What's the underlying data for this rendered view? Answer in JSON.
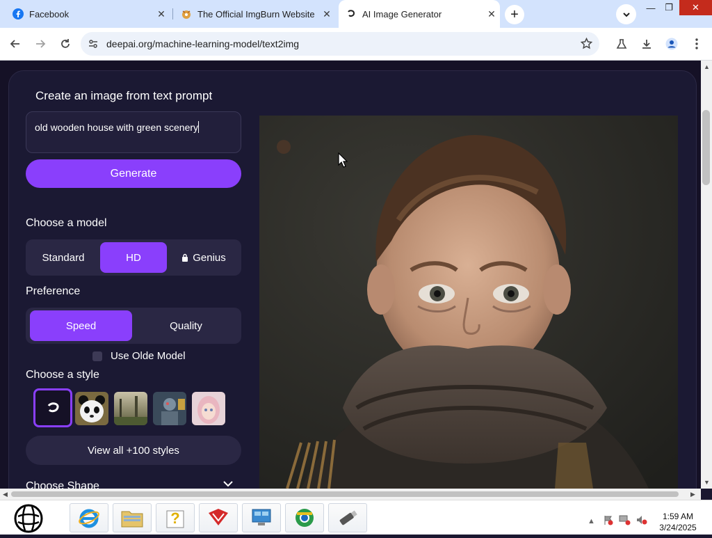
{
  "browser": {
    "tabs": [
      {
        "title": "Facebook",
        "active": false,
        "favicon": "facebook-icon"
      },
      {
        "title": "The Official ImgBurn Website",
        "active": false,
        "favicon": "imgburn-icon"
      },
      {
        "title": "AI Image Generator",
        "active": true,
        "favicon": "deepai-icon"
      }
    ],
    "url": "deepai.org/machine-learning-model/text2img"
  },
  "page": {
    "heading": "Create an image from text prompt",
    "prompt_value": "old wooden house with green scenery",
    "generate_label": "Generate",
    "model": {
      "heading": "Choose a model",
      "options": [
        "Standard",
        "HD",
        "Genius"
      ],
      "selected": "HD"
    },
    "preference": {
      "heading": "Preference",
      "options": [
        "Speed",
        "Quality"
      ],
      "selected": "Speed"
    },
    "olde_label": "Use Olde Model",
    "style": {
      "heading": "Choose a style",
      "view_all_label": "View all +100 styles"
    },
    "shape_heading": "Choose Shape",
    "generated_image": "boy-portrait-brown-scarf"
  },
  "taskbar": {
    "time": "1:59 AM",
    "date": "3/24/2025"
  },
  "colors": {
    "accent": "#8a3ffc",
    "page_bg": "#151126",
    "card_bg": "#1b1933",
    "tab_strip": "#d3e3fd"
  }
}
